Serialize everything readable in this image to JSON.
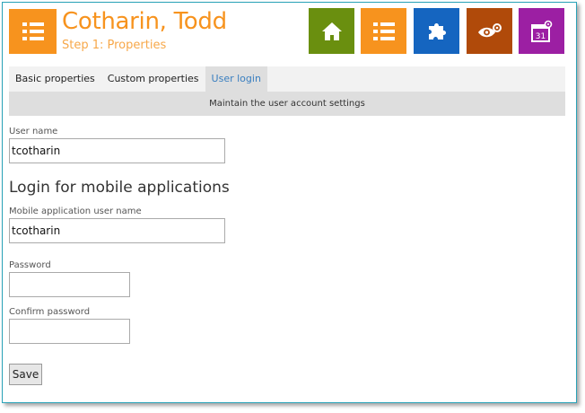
{
  "header": {
    "title": "Cotharin, Todd",
    "subtitle": "Step 1: Properties",
    "logo_icon": "list-icon",
    "tiles": [
      {
        "name": "home-icon",
        "color": "#6a8f0f"
      },
      {
        "name": "list-icon",
        "color": "#f7931e"
      },
      {
        "name": "puzzle-icon",
        "color": "#1565c0"
      },
      {
        "name": "eye-gear-icon",
        "color": "#b04a0a"
      },
      {
        "name": "calendar-gear-icon",
        "color": "#9c1fa3",
        "day": "31"
      }
    ]
  },
  "tabs": [
    {
      "label": "Basic properties",
      "active": false
    },
    {
      "label": "Custom properties",
      "active": false
    },
    {
      "label": "User login",
      "active": true
    }
  ],
  "description": "Maintain the user account settings",
  "form": {
    "user_name_label": "User name",
    "user_name_value": "tcotharin",
    "mobile_section_title": "Login for mobile applications",
    "mobile_user_name_label": "Mobile application user name",
    "mobile_user_name_value": "tcotharin",
    "password_label": "Password",
    "password_value": "",
    "confirm_password_label": "Confirm password",
    "confirm_password_value": "",
    "save_label": "Save"
  },
  "colors": {
    "accent": "#f7931e",
    "active_tab_text": "#3a7fc0",
    "frame_border": "#2aa3b8"
  }
}
